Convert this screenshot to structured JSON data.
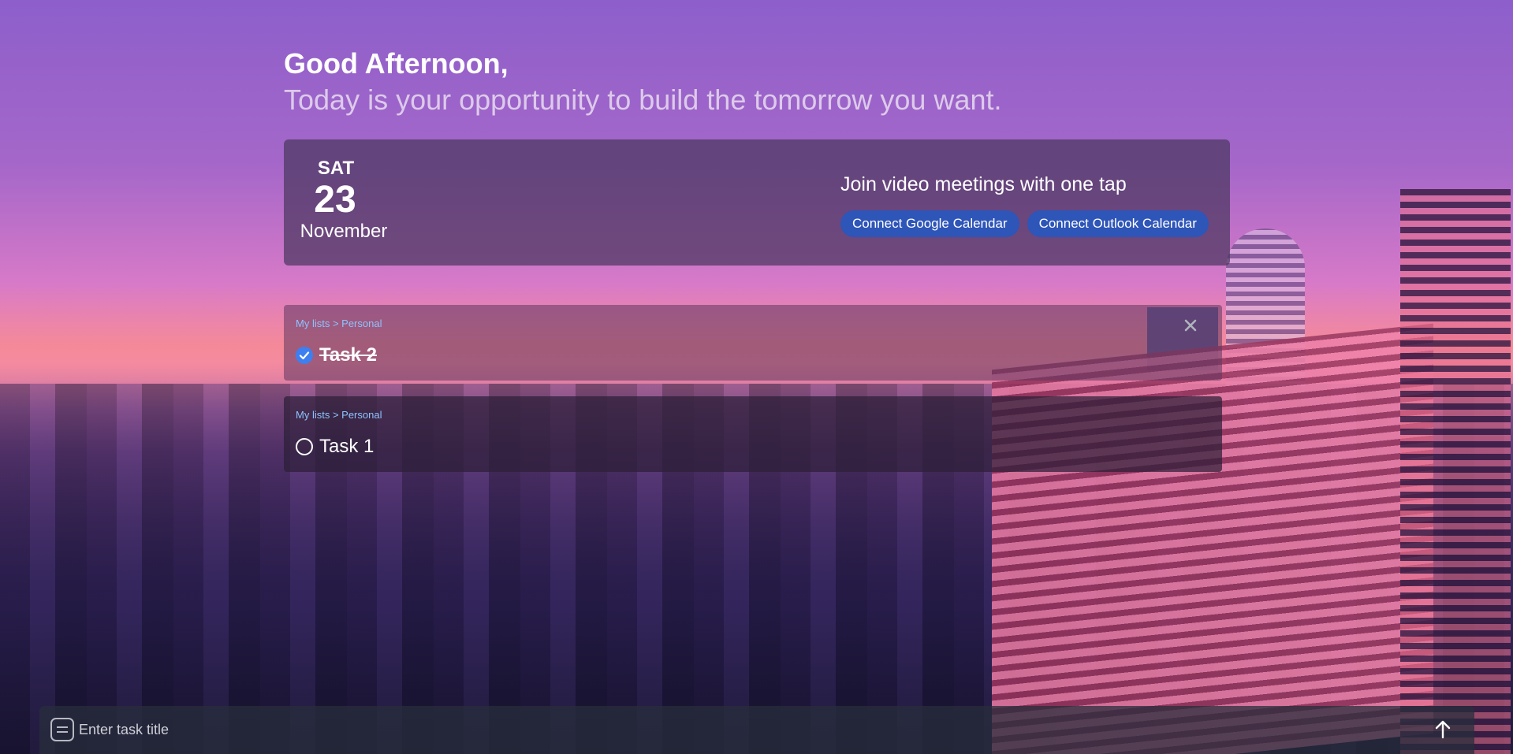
{
  "greeting": {
    "title": "Good Afternoon,",
    "subtitle": "Today is your opportunity to build the tomorrow you want."
  },
  "calendar": {
    "day_of_week": "SAT",
    "day_number": "23",
    "month": "November",
    "promo_title": "Join video meetings with one tap",
    "connect_google_label": "Connect Google Calendar",
    "connect_outlook_label": "Connect Outlook Calendar",
    "button_color": "#2e55b8"
  },
  "tasks": [
    {
      "breadcrumb": "My lists > Personal",
      "title": "Task 2",
      "completed": true,
      "check_icon": "check-circle-icon",
      "close_icon": "close-icon"
    },
    {
      "breadcrumb": "My lists > Personal",
      "title": "Task 1",
      "completed": false,
      "check_icon": "empty-circle-icon"
    }
  ],
  "composer": {
    "placeholder": "Enter task title",
    "value": "",
    "list_icon": "list-icon",
    "send_icon": "arrow-up-icon"
  },
  "colors": {
    "accent_link": "#8cc4ff",
    "check_blue": "#3d7ff0"
  }
}
